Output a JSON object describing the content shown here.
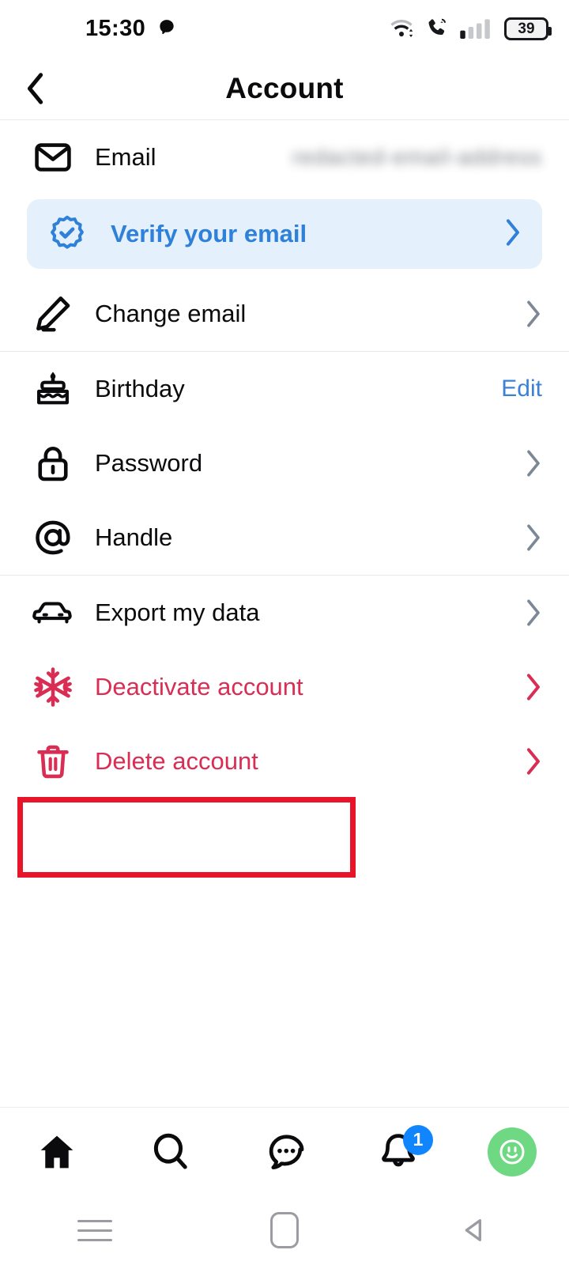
{
  "status_bar": {
    "time": "15:30",
    "icons": [
      "notification-dot-icon",
      "wifi-icon",
      "wifi-calling-icon",
      "cellular-signal-icon"
    ],
    "battery_level": "39"
  },
  "header": {
    "back_icon": "chevron-left-icon",
    "title": "Account"
  },
  "sections": [
    {
      "id": "email-section",
      "rows": [
        {
          "id": "email",
          "icon": "envelope-icon",
          "label": "Email",
          "value": "redacted-email-address",
          "value_redacted": true,
          "accessory": "none"
        },
        {
          "id": "verify-email",
          "icon": "verified-badge-icon",
          "label": "Verify your email",
          "accessory": "chevron-right-icon",
          "style": "banner"
        },
        {
          "id": "change-email",
          "icon": "pencil-edit-icon",
          "label": "Change email",
          "accessory": "chevron-right-icon"
        }
      ]
    },
    {
      "id": "profile-section",
      "rows": [
        {
          "id": "birthday",
          "icon": "birthday-cake-icon",
          "label": "Birthday",
          "accessory": "edit-link",
          "action_label": "Edit"
        },
        {
          "id": "password",
          "icon": "lock-icon",
          "label": "Password",
          "accessory": "chevron-right-icon"
        },
        {
          "id": "handle",
          "icon": "at-sign-icon",
          "label": "Handle",
          "accessory": "chevron-right-icon"
        }
      ]
    },
    {
      "id": "data-section",
      "rows": [
        {
          "id": "export-data",
          "icon": "car-export-icon",
          "label": "Export my data",
          "accessory": "chevron-right-icon"
        },
        {
          "id": "deactivate-account",
          "icon": "snowflake-icon",
          "label": "Deactivate account",
          "accessory": "chevron-right-icon",
          "danger": true
        },
        {
          "id": "delete-account",
          "icon": "trash-icon",
          "label": "Delete account",
          "accessory": "chevron-right-icon",
          "danger": true,
          "highlighted": true
        }
      ]
    }
  ],
  "bottom_nav": [
    {
      "id": "home",
      "icon": "home-icon",
      "active": true
    },
    {
      "id": "search",
      "icon": "search-icon",
      "active": false
    },
    {
      "id": "messages",
      "icon": "chat-bubble-icon",
      "active": false
    },
    {
      "id": "notifications",
      "icon": "bell-icon",
      "active": false,
      "badge": "1"
    },
    {
      "id": "profile",
      "icon": "avatar-smiley-icon",
      "active": false
    }
  ],
  "android_nav": [
    {
      "id": "recents",
      "icon": "recents-icon"
    },
    {
      "id": "home",
      "icon": "home-square-icon"
    },
    {
      "id": "back",
      "icon": "back-triangle-icon"
    }
  ],
  "colors": {
    "accent_blue": "#2f80d8",
    "banner_bg": "#e4f0fc",
    "danger_red": "#d92d54",
    "badge_blue": "#1185fe",
    "avatar_green": "#6ed882",
    "highlight_red": "#e8152a",
    "text_primary": "#0b0b0d",
    "chevron_gray": "#7c8894"
  }
}
